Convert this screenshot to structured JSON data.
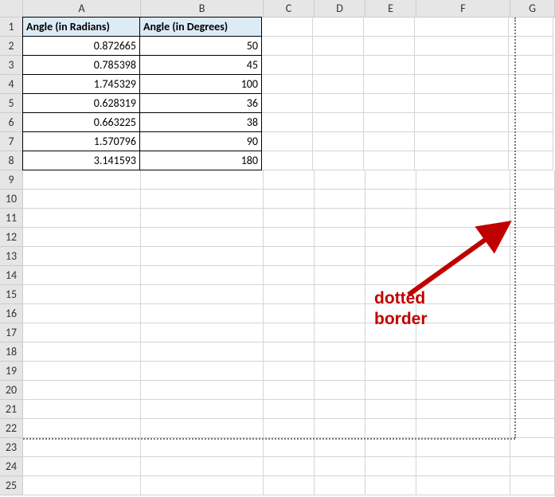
{
  "columns": [
    "A",
    "B",
    "C",
    "D",
    "E",
    "F",
    "G"
  ],
  "rowCount": 25,
  "headers": {
    "A": "Angle (in Radians)",
    "B": "Angle (in Degrees)"
  },
  "data": [
    {
      "rad": "0.872665",
      "deg": "50"
    },
    {
      "rad": "0.785398",
      "deg": "45"
    },
    {
      "rad": "1.745329",
      "deg": "100"
    },
    {
      "rad": "0.628319",
      "deg": "36"
    },
    {
      "rad": "0.663225",
      "deg": "38"
    },
    {
      "rad": "1.570796",
      "deg": "90"
    },
    {
      "rad": "3.141593",
      "deg": "180"
    }
  ],
  "annotation": {
    "line1": "dotted",
    "line2": "border"
  },
  "chart_data": {
    "type": "table",
    "title": "",
    "columns": [
      "Angle (in Radians)",
      "Angle (in Degrees)"
    ],
    "rows": [
      [
        0.872665,
        50
      ],
      [
        0.785398,
        45
      ],
      [
        1.745329,
        100
      ],
      [
        0.628319,
        36
      ],
      [
        0.663225,
        38
      ],
      [
        1.570796,
        90
      ],
      [
        3.141593,
        180
      ]
    ]
  }
}
